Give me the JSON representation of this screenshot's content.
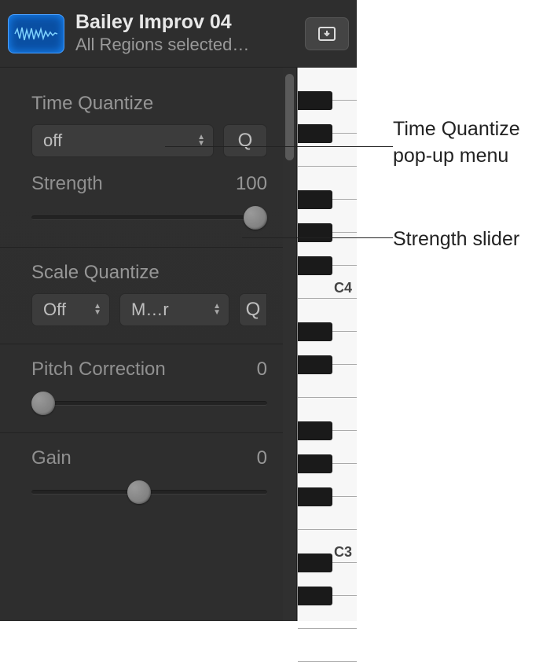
{
  "header": {
    "title": "Bailey Improv 04",
    "subtitle": "All Regions selected…",
    "inspector_button_name": "list-view-button"
  },
  "time_quantize": {
    "label": "Time Quantize",
    "popup_value": "off",
    "q_button": "Q",
    "strength_label": "Strength",
    "strength_value": "100",
    "strength_pct": 100
  },
  "scale_quantize": {
    "label": "Scale Quantize",
    "popup1_value": "Off",
    "popup2_value": "M…r",
    "q_button": "Q"
  },
  "pitch_correction": {
    "label": "Pitch Correction",
    "value": "0",
    "pct": 0
  },
  "gain": {
    "label": "Gain",
    "value": "0",
    "pct": 45
  },
  "piano": {
    "label_c4": "C4",
    "label_c3": "C3"
  },
  "callouts": {
    "time_quantize": "Time Quantize pop-up menu",
    "strength": "Strength slider"
  }
}
